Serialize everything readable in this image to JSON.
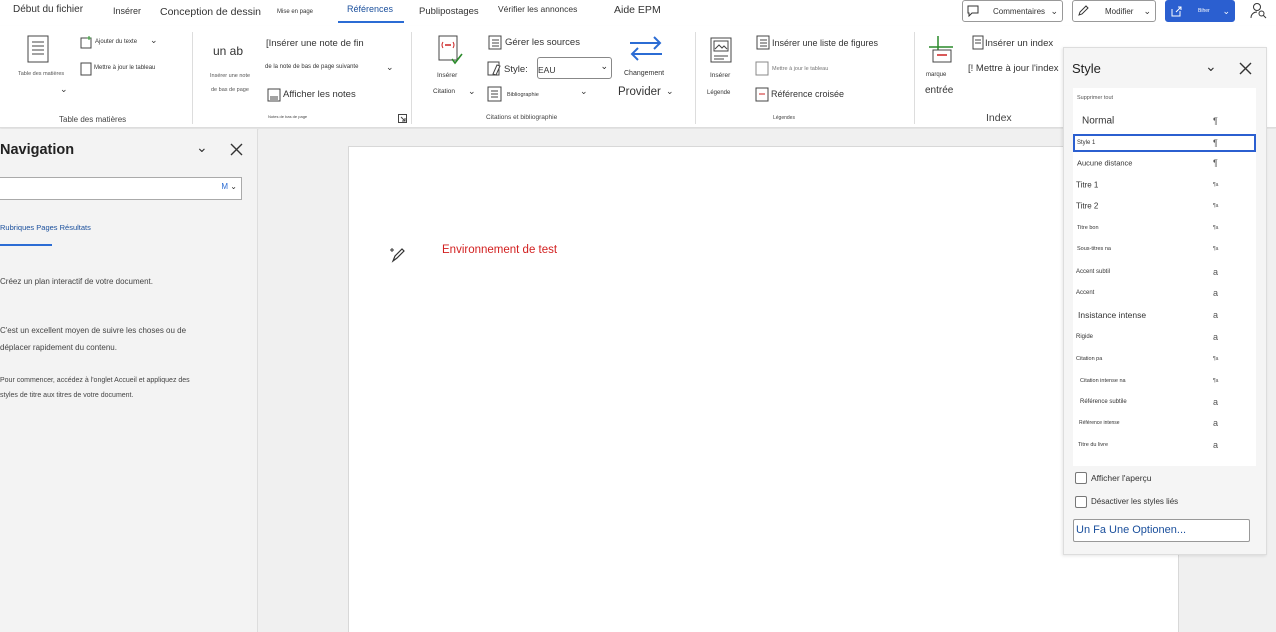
{
  "tabs": [
    "Début du fichier",
    "Insérer",
    "Conception de dessin",
    "Mise en page",
    "Références",
    "Publipostages",
    "Vérifier les annonces",
    "Aide EPM"
  ],
  "top_buttons": {
    "comments": "Commentaires",
    "edit": "Modifier",
    "share": "Biher"
  },
  "ribbon": {
    "toc": {
      "big_label": "Table des matières",
      "add_text": "Ajouter du texte",
      "update_table": "Mettre à jour le tableau",
      "group": "Table des matières"
    },
    "footnotes": {
      "big_label": "un ab",
      "insert_note_l1": "Insérer une note",
      "insert_note_l2": "de bas de page",
      "insert_endnote": "[Insérer une note de fin",
      "next_note": "de la note de bas de page suivante",
      "show_notes": "Afficher les notes",
      "group": "Notes de bas de page"
    },
    "citations": {
      "insert_l1": "Insérer",
      "insert_l2": "Citation",
      "manage_sources": "Gérer les sources",
      "style_label": "Style:",
      "style_value": "EAU",
      "bibliography": "Bibliographie",
      "change": "Changement",
      "provider": "Provider",
      "group": "Citations et bibliographie"
    },
    "captions": {
      "insert_l1": "Insérer",
      "insert_l2": "Légende",
      "insert_figures": "Insérer une liste de figures",
      "update_table": "Mettre à jour le tableau",
      "cross_ref": "Référence croisée",
      "group": "Légendes"
    },
    "index": {
      "mark_l1": "marque",
      "mark_l2": "entrée",
      "insert_index": "Insérer un index",
      "update_index": "[! Mettre à jour l'index",
      "group": "Index"
    }
  },
  "navigation": {
    "title": "Navigation",
    "search_btn": "M",
    "tabs_text": "Rubriques Pages Résultats",
    "p1": "Créez un plan interactif de votre document.",
    "p2_l1": "C'est un excellent moyen de suivre les choses ou de",
    "p2_l2": "déplacer rapidement du contenu.",
    "p3_l1": "Pour commencer, accédez à l'onglet Accueil et appliquez des",
    "p3_l2": "styles de titre aux titres de votre document."
  },
  "document": {
    "text": "Environnement de test"
  },
  "style_pane": {
    "title": "Style",
    "clear_all": "Supprimer tout",
    "items": [
      {
        "label": "Normal",
        "mark": "¶"
      },
      {
        "label": "Style 1",
        "mark": "¶"
      },
      {
        "label": "Aucune distance",
        "mark": "¶"
      },
      {
        "label": "Titre 1",
        "mark": "¶a"
      },
      {
        "label": "Titre 2",
        "mark": "¶a"
      },
      {
        "label": "Titre bon",
        "mark": "¶a"
      },
      {
        "label": "Sous-titres na",
        "mark": "¶a"
      },
      {
        "label": "Accent subtil",
        "mark": "a"
      },
      {
        "label": "Accent",
        "mark": "a"
      },
      {
        "label": "Insistance intense",
        "mark": "a"
      },
      {
        "label": "Rigide",
        "mark": "a"
      },
      {
        "label": "Citation pa",
        "mark": "¶a"
      },
      {
        "label": "Citation intense na",
        "mark": "¶a"
      },
      {
        "label": "Référence subtile",
        "mark": "a"
      },
      {
        "label": "Référence intense",
        "mark": "a"
      },
      {
        "label": "Titre du livre",
        "mark": "a"
      }
    ],
    "show_preview": "Afficher l'aperçu",
    "disable_linked": "Désactiver les styles liés",
    "options_button": "Un Fa Une Optionen..."
  }
}
